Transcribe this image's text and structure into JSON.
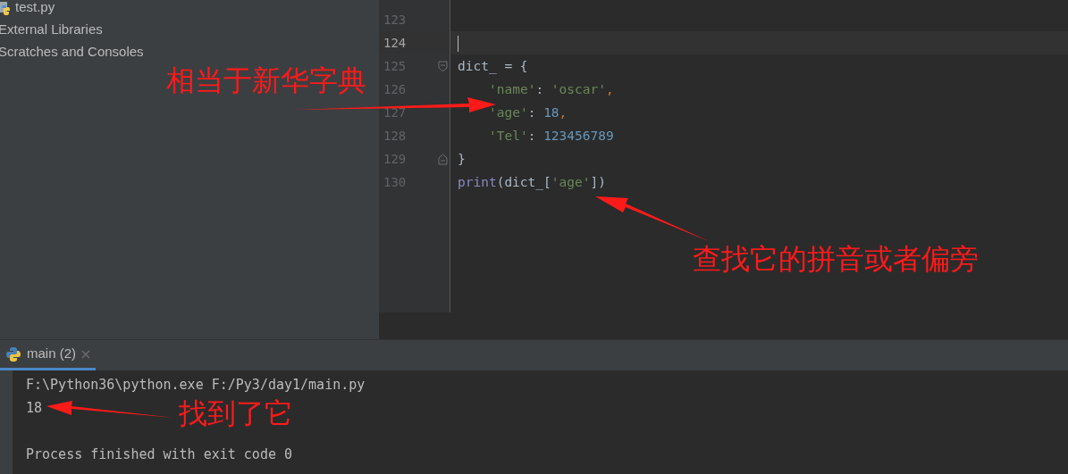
{
  "project_tree": {
    "items": [
      {
        "label": "test.py",
        "kind": "python-file"
      },
      {
        "label": "External Libraries",
        "kind": "folder"
      },
      {
        "label": "Scratches and Consoles",
        "kind": "folder"
      }
    ]
  },
  "editor": {
    "lines": [
      {
        "number": "123",
        "current": false
      },
      {
        "number": "124",
        "current": true
      },
      {
        "number": "125",
        "current": false,
        "fold_start": true,
        "tokens": [
          {
            "text": "dict_ = {",
            "kind": "plain"
          }
        ]
      },
      {
        "number": "126",
        "current": false,
        "indented": true,
        "tokens": [
          {
            "text": "'name'",
            "kind": "string"
          },
          {
            "text": ": ",
            "kind": "plain"
          },
          {
            "text": "'oscar'",
            "kind": "string"
          },
          {
            "text": ",",
            "kind": "punct"
          }
        ]
      },
      {
        "number": "127",
        "current": false,
        "indented": true,
        "tokens": [
          {
            "text": "'age'",
            "kind": "string"
          },
          {
            "text": ": ",
            "kind": "plain"
          },
          {
            "text": "18",
            "kind": "number"
          },
          {
            "text": ",",
            "kind": "punct"
          }
        ]
      },
      {
        "number": "128",
        "current": false,
        "indented": true,
        "tokens": [
          {
            "text": "'Tel'",
            "kind": "string"
          },
          {
            "text": ": ",
            "kind": "plain"
          },
          {
            "text": "123456789",
            "kind": "number"
          }
        ]
      },
      {
        "number": "129",
        "current": false,
        "fold_end": true,
        "tokens": [
          {
            "text": "}",
            "kind": "plain"
          }
        ]
      },
      {
        "number": "130",
        "current": false,
        "tokens": [
          {
            "text": "print",
            "kind": "builtin"
          },
          {
            "text": "(dict_[",
            "kind": "plain"
          },
          {
            "text": "'age'",
            "kind": "string"
          },
          {
            "text": "])",
            "kind": "plain"
          }
        ]
      }
    ]
  },
  "run_panel": {
    "tab": {
      "label": "main (2)",
      "selected": true
    },
    "output": [
      "F:\\Python36\\python.exe F:/Py3/day1/main.py",
      "18"
    ],
    "exit_message": "Process finished with exit code 0"
  },
  "annotations": [
    {
      "text": "相当于新华字典"
    },
    {
      "text": "查找它的拼音或者偏旁"
    },
    {
      "text": "找到了它"
    }
  ]
}
